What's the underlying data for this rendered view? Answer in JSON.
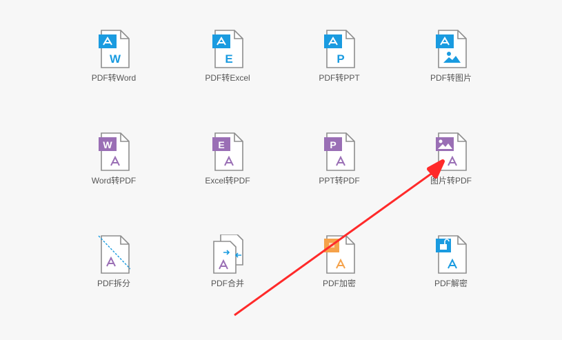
{
  "colors": {
    "blue": "#1a9be0",
    "purple": "#9a6fb5",
    "orange": "#f5a24a",
    "annotation_red": "#ff2a2a",
    "label": "#555555"
  },
  "tools": [
    {
      "label": "PDF转Word",
      "icon": "pdf-to-word-icon"
    },
    {
      "label": "PDF转Excel",
      "icon": "pdf-to-excel-icon"
    },
    {
      "label": "PDF转PPT",
      "icon": "pdf-to-ppt-icon"
    },
    {
      "label": "PDF转图片",
      "icon": "pdf-to-image-icon"
    },
    {
      "label": "Word转PDF",
      "icon": "word-to-pdf-icon"
    },
    {
      "label": "Excel转PDF",
      "icon": "excel-to-pdf-icon"
    },
    {
      "label": "PPT转PDF",
      "icon": "ppt-to-pdf-icon"
    },
    {
      "label": "图片转PDF",
      "icon": "image-to-pdf-icon"
    },
    {
      "label": "PDF拆分",
      "icon": "pdf-split-icon"
    },
    {
      "label": "PDF合并",
      "icon": "pdf-merge-icon"
    },
    {
      "label": "PDF加密",
      "icon": "pdf-encrypt-icon"
    },
    {
      "label": "PDF解密",
      "icon": "pdf-decrypt-icon"
    }
  ],
  "badges": {
    "word": "W",
    "excel": "E",
    "ppt": "P"
  }
}
